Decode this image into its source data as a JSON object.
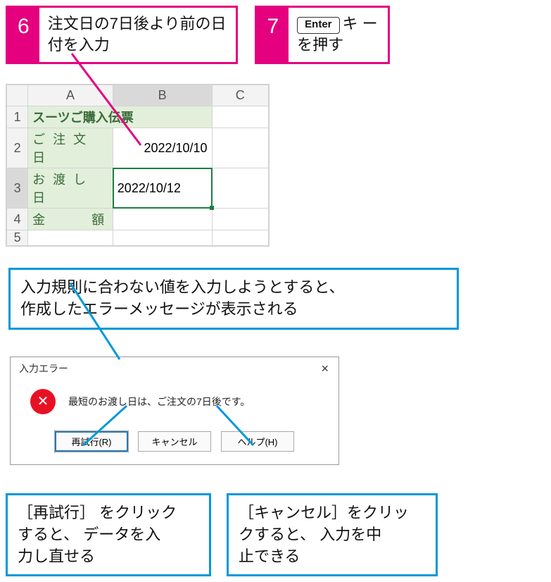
{
  "steps": {
    "s6": {
      "num": "6",
      "text": "注文日の7日後より前の日\n付を入力"
    },
    "s7": {
      "num": "7",
      "key": "Enter",
      "tail": "キ ー",
      "line2": "を押す"
    }
  },
  "grid": {
    "colA": "A",
    "colB": "B",
    "colC": "C",
    "r1": "1",
    "r2": "2",
    "r3": "3",
    "r4": "4",
    "r5": "5",
    "title": "スーツご購入伝票",
    "orderLabel": "ご 注 文 日",
    "deliverLabel": "お 渡 し 日",
    "amountLabel": "金　　　額",
    "orderDate": "2022/10/10",
    "deliverDate": "2022/10/12"
  },
  "blue1": "入力規則に合わない値を入力しようとすると、\n作成したエラーメッセージが表示される",
  "dialog": {
    "title": "入力エラー",
    "close": "×",
    "icon": "✕",
    "message": "最短のお渡し日は、ご注文の7日後です。",
    "retry": "再試行(R)",
    "cancel": "キャンセル",
    "help": "ヘルプ(H)"
  },
  "blueRetry": "［再試行］ をクリック\nすると、 データを入\n力し直せる",
  "blueCancel": "［キャンセル］をクリッ\nクすると、 入力を中\n止できる"
}
